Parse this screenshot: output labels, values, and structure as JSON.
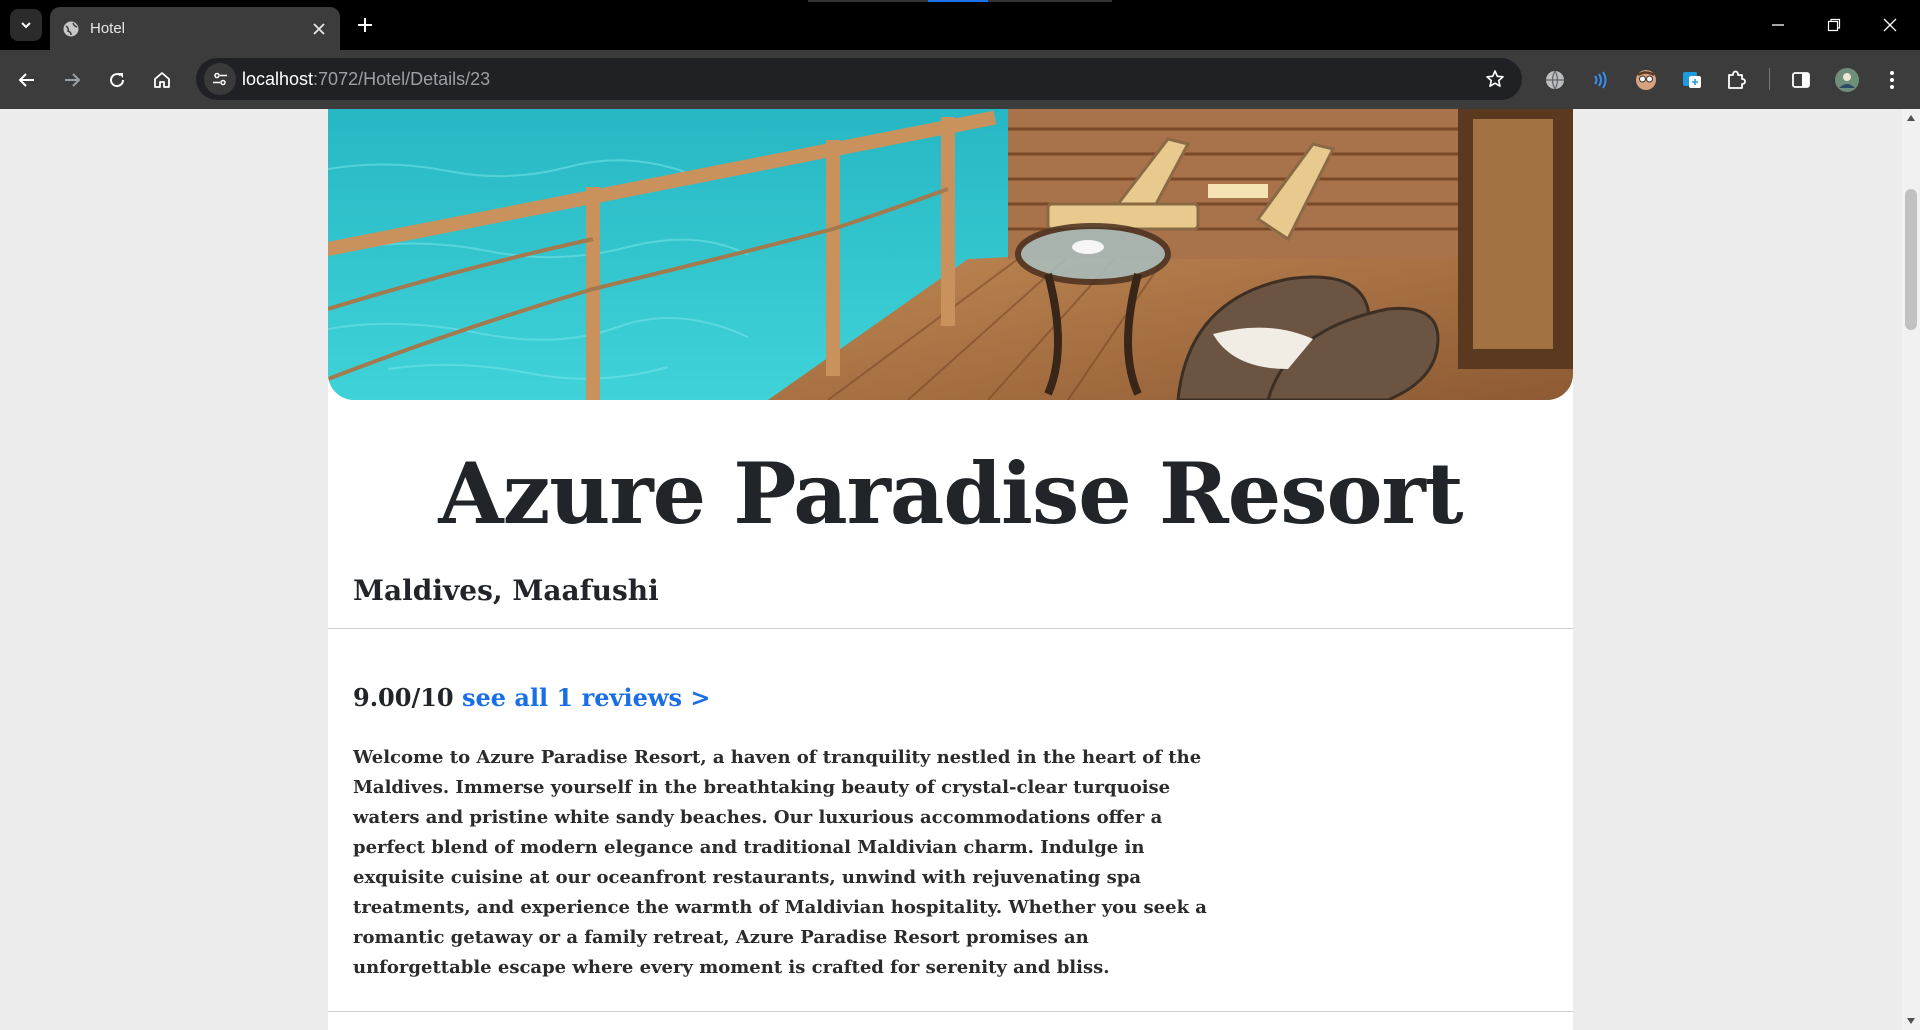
{
  "browser": {
    "tab_title": "Hotel",
    "url_host": "localhost",
    "url_path": ":7072/Hotel/Details/23"
  },
  "icons": {
    "tab_search": "chevron-down-icon",
    "tab_favicon": "globe-icon",
    "tab_close": "close-icon",
    "new_tab": "plus-icon",
    "back": "arrow-left-icon",
    "forward": "arrow-right-icon",
    "reload": "reload-icon",
    "home": "home-icon",
    "site_info": "tune-icon",
    "bookmark": "star-icon",
    "extensions": [
      "globe-extension-icon",
      "wifi-extension-icon",
      "avatar-extension-icon",
      "translate-extension-icon",
      "puzzle-icon"
    ],
    "side_panel": "side-panel-icon",
    "profile": "profile-avatar-icon",
    "menu": "more-vertical-icon"
  },
  "hotel": {
    "name": "Azure Paradise Resort",
    "location": "Maldives, Maafushi",
    "rating": "9.00/10",
    "reviews_link": "see all 1 reviews >",
    "description": "Welcome to Azure Paradise Resort, a haven of tranquility nestled in the heart of the Maldives. Immerse yourself in the breathtaking beauty of crystal-clear turquoise waters and pristine white sandy beaches. Our luxurious accommodations offer a perfect blend of modern elegance and traditional Maldivian charm. Indulge in exquisite cuisine at our oceanfront restaurants, unwind with rejuvenating spa treatments, and experience the warmth of Maldivian hospitality. Whether you seek a romantic getaway or a family retreat, Azure Paradise Resort promises an unforgettable escape where every moment is crafted for serenity and bliss."
  },
  "colors": {
    "link": "#1a6ee8",
    "text": "#212529",
    "water": "#2ec4cf",
    "deck": "#b07a4a"
  }
}
